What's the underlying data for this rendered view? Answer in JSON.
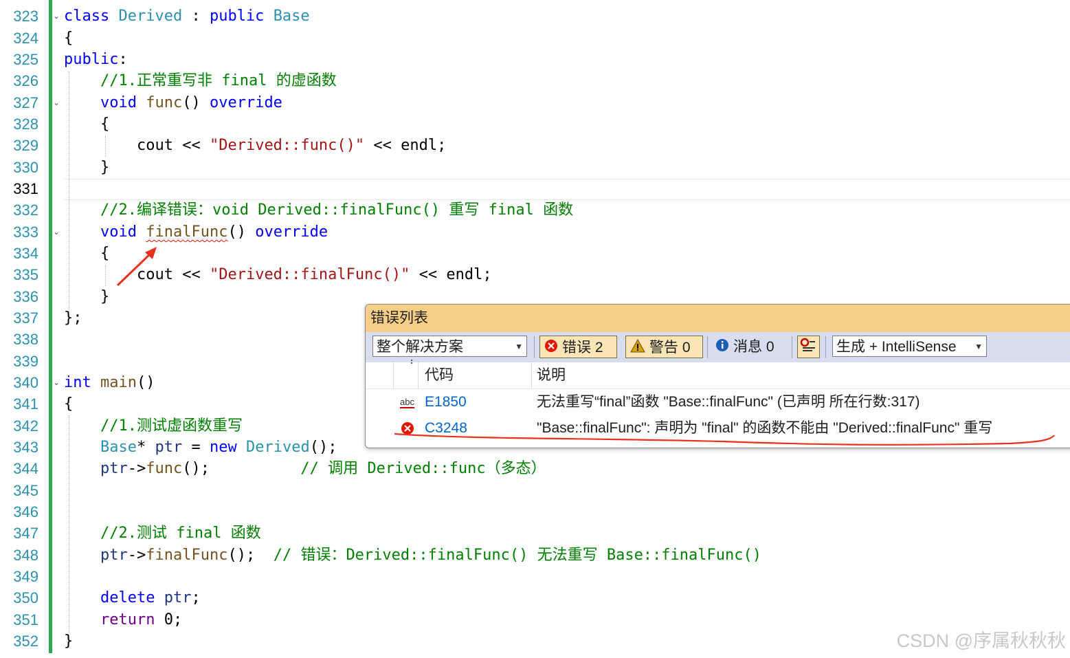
{
  "editor": {
    "line_numbers": [
      "323",
      "324",
      "325",
      "326",
      "327",
      "328",
      "329",
      "330",
      "331",
      "332",
      "333",
      "334",
      "335",
      "336",
      "337",
      "338",
      "339",
      "340",
      "341",
      "342",
      "343",
      "344",
      "345",
      "346",
      "347",
      "348",
      "349",
      "350",
      "351",
      "352"
    ],
    "active_line": "331",
    "lines": {
      "l323": {
        "a": "class",
        "b": " ",
        "c": "Derived",
        "d": " : ",
        "e": "public",
        "f": " ",
        "g": "Base"
      },
      "l324": {
        "a": "{"
      },
      "l325": {
        "a": "public",
        "b": ":"
      },
      "l326": {
        "a": "//1.正常重写非 final 的虚函数"
      },
      "l327": {
        "a": "void",
        "b": " ",
        "c": "func",
        "d": "() ",
        "e": "override"
      },
      "l328": {
        "a": "{"
      },
      "l329": {
        "a": "cout",
        "b": " << ",
        "c": "\"Derived::func()\"",
        "d": " << ",
        "e": "endl",
        "f": ";"
      },
      "l330": {
        "a": "}"
      },
      "l332": {
        "a": "//2.编译错误：void Derived::finalFunc() 重写 final 函数"
      },
      "l333": {
        "a": "void",
        "b": " ",
        "c": "finalFunc",
        "d": "() ",
        "e": "override"
      },
      "l334": {
        "a": "{"
      },
      "l335": {
        "a": "cout",
        "b": " << ",
        "c": "\"Derived::finalFunc()\"",
        "d": " << ",
        "e": "endl",
        "f": ";"
      },
      "l336": {
        "a": "}"
      },
      "l337": {
        "a": "};"
      },
      "l340": {
        "a": "int",
        "b": " ",
        "c": "main",
        "d": "()"
      },
      "l341": {
        "a": "{"
      },
      "l342": {
        "a": "//1.测试虚函数重写"
      },
      "l343": {
        "a": "Base",
        "b": "* ",
        "c": "ptr",
        "d": " = ",
        "e": "new",
        "f": " ",
        "g": "Derived",
        "h": "();"
      },
      "l344": {
        "a": "ptr",
        "b": "->",
        "c": "func",
        "d": "();          ",
        "e": "// 调用 Derived::func（多态）"
      },
      "l347": {
        "a": "//2.测试 final 函数"
      },
      "l348": {
        "a": "ptr",
        "b": "->",
        "c": "finalFunc",
        "d": "();  ",
        "e": "// 错误：Derived::finalFunc() 无法重写 Base::finalFunc()"
      },
      "l350": {
        "a": "delete",
        "b": " ",
        "c": "ptr",
        "d": ";"
      },
      "l351": {
        "a": "return",
        "b": " 0;"
      },
      "l352": {
        "a": "}"
      }
    }
  },
  "error_list": {
    "title": "错误列表",
    "scope_combo": "整个解决方案",
    "errors_label": "错误 2",
    "warnings_label": "警告 0",
    "messages_label": "消息 0",
    "build_combo": "生成 + IntelliSense",
    "columns": {
      "code": "代码",
      "description": "说明"
    },
    "rows": [
      {
        "icon": "intellisense-abc-icon",
        "code": "E1850",
        "description": "无法重写“final”函数 \"Base::finalFunc\" (已声明 所在行数:317)"
      },
      {
        "icon": "error-circle-icon",
        "code": "C3248",
        "description": "\"Base::finalFunc\": 声明为 \"final\" 的函数不能由 \"Derived::finalFunc\" 重写"
      }
    ],
    "colors": {
      "title_bg": "#f5cf87",
      "toolbar_bg": "#d9ddf0",
      "error_red": "#e51400"
    }
  },
  "watermark": "CSDN @序属秋秋秋"
}
